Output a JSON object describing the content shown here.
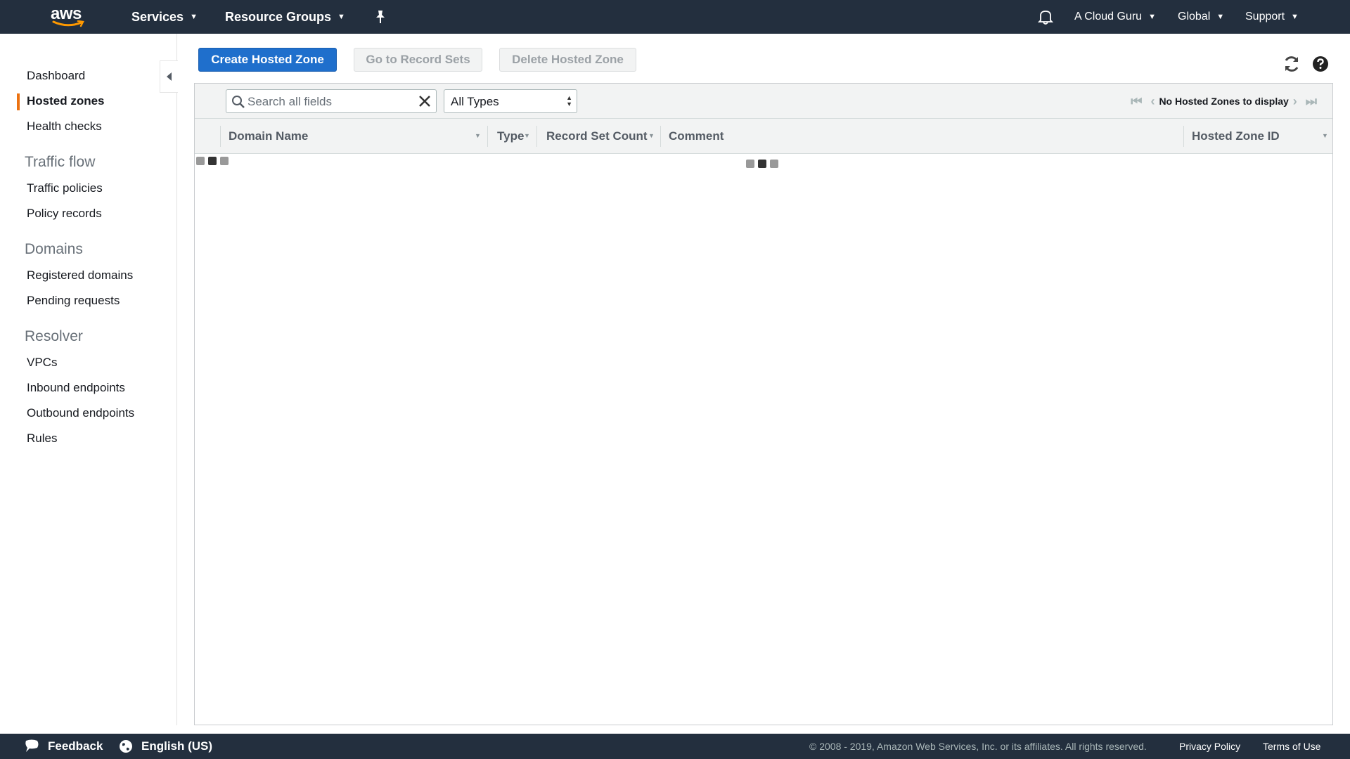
{
  "topnav": {
    "logo": "aws",
    "services": "Services",
    "resource_groups": "Resource Groups",
    "account": "A Cloud Guru",
    "region": "Global",
    "support": "Support"
  },
  "sidebar": {
    "dashboard": "Dashboard",
    "hosted_zones": "Hosted zones",
    "health_checks": "Health checks",
    "traffic_flow_heading": "Traffic flow",
    "traffic_policies": "Traffic policies",
    "policy_records": "Policy records",
    "domains_heading": "Domains",
    "registered_domains": "Registered domains",
    "pending_requests": "Pending requests",
    "resolver_heading": "Resolver",
    "vpcs": "VPCs",
    "inbound_endpoints": "Inbound endpoints",
    "outbound_endpoints": "Outbound endpoints",
    "rules": "Rules"
  },
  "toolbar": {
    "create": "Create Hosted Zone",
    "go_to_record_sets": "Go to Record Sets",
    "delete": "Delete Hosted Zone"
  },
  "filter": {
    "search_placeholder": "Search all fields",
    "type_value": "All Types",
    "pager_text": "No Hosted Zones to display"
  },
  "table": {
    "columns": {
      "domain_name": "Domain Name",
      "type": "Type",
      "record_set_count": "Record Set Count",
      "comment": "Comment",
      "hosted_zone_id": "Hosted Zone ID"
    }
  },
  "footer": {
    "feedback": "Feedback",
    "language": "English (US)",
    "copyright": "© 2008 - 2019, Amazon Web Services, Inc. or its affiliates. All rights reserved.",
    "privacy": "Privacy Policy",
    "terms": "Terms of Use"
  },
  "colors": {
    "nav_bg": "#232f3e",
    "primary_button": "#1f6fcc",
    "active_accent": "#ec7211"
  }
}
